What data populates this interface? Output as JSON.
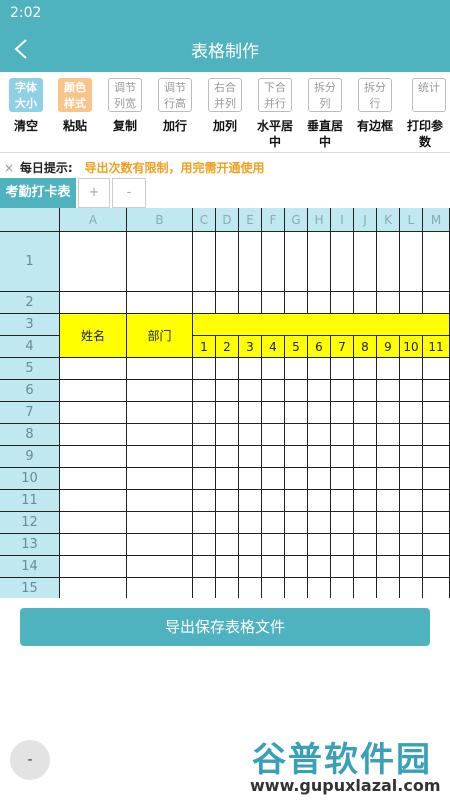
{
  "status": {
    "time": "2:02"
  },
  "header": {
    "title": "表格制作"
  },
  "toolbar_top": [
    {
      "label": "字体大小",
      "style": "blue"
    },
    {
      "label": "颜色样式",
      "style": "orange"
    },
    {
      "label": "调节列宽",
      "style": "plain"
    },
    {
      "label": "调节行高",
      "style": "plain"
    },
    {
      "label": "右合并列",
      "style": "plain"
    },
    {
      "label": "下合并行",
      "style": "plain"
    },
    {
      "label": "拆分列",
      "style": "plain"
    },
    {
      "label": "拆分行",
      "style": "plain"
    },
    {
      "label": "统计",
      "style": "plain"
    }
  ],
  "toolbar_bottom": [
    "清空",
    "粘贴",
    "复制",
    "加行",
    "加列",
    "水平居中",
    "垂直居中",
    "有边框",
    "打印参数"
  ],
  "tip": {
    "close": "×",
    "label": "每日提示:",
    "message": "导出次数有限制，用完需开通使用"
  },
  "sheets": {
    "active": "考勤打卡表",
    "add": "+",
    "remove": "-"
  },
  "grid": {
    "column_headers": [
      "A",
      "B",
      "C",
      "D",
      "E",
      "F",
      "G",
      "H",
      "I",
      "J",
      "K",
      "L",
      "M"
    ],
    "row_headers": [
      "1",
      "2",
      "3",
      "4",
      "5",
      "6",
      "7",
      "8",
      "9",
      "10",
      "11",
      "12",
      "13",
      "14",
      "15"
    ],
    "header_cells": {
      "name": "姓名",
      "dept": "部门"
    },
    "day_numbers": [
      "1",
      "2",
      "3",
      "4",
      "5",
      "6",
      "7",
      "8",
      "9",
      "10",
      "11"
    ]
  },
  "actions": {
    "export": "导出保存表格文件",
    "minus": "-"
  },
  "watermark": {
    "big": "谷普软件园",
    "small": "www.gupuxlazal.com"
  },
  "colors": {
    "accent": "#4fb3bf",
    "header_fill": "#bfe8f1",
    "highlight": "#ffff00",
    "tip": "#f0a020"
  }
}
